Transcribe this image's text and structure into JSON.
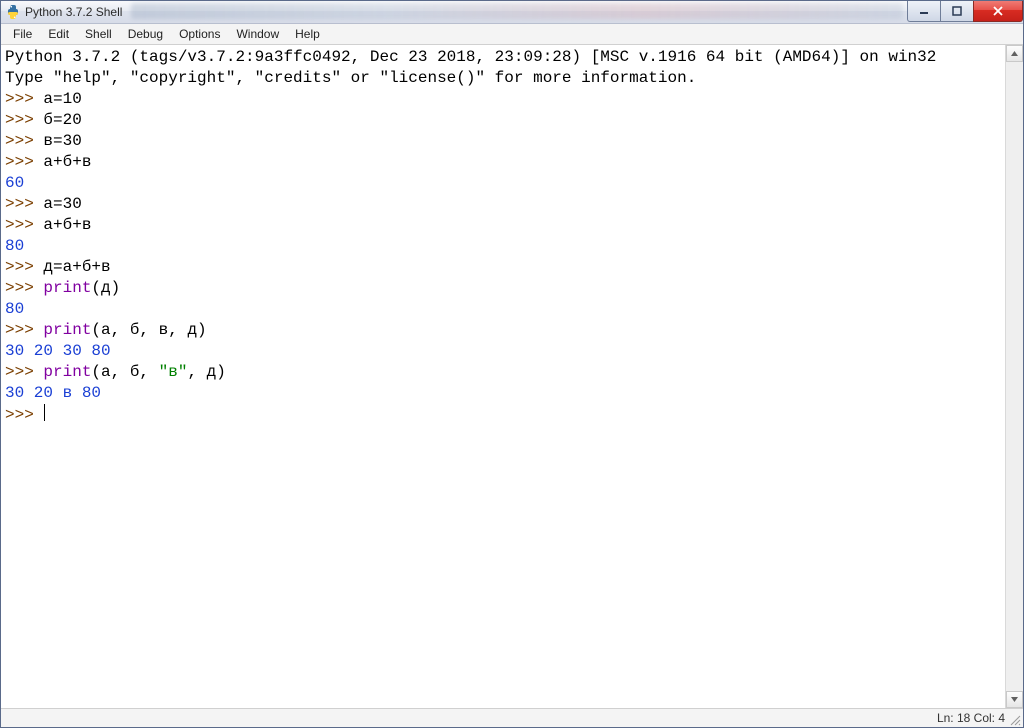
{
  "window": {
    "title": "Python 3.7.2 Shell"
  },
  "menubar": {
    "items": [
      "File",
      "Edit",
      "Shell",
      "Debug",
      "Options",
      "Window",
      "Help"
    ]
  },
  "terminal": {
    "banner1": "Python 3.7.2 (tags/v3.7.2:9a3ffc0492, Dec 23 2018, 23:09:28) [MSC v.1916 64 bit (AMD64)] on win32",
    "banner2": "Type \"help\", \"copyright\", \"credits\" or \"license()\" for more information.",
    "prompt": ">>> ",
    "lines": {
      "l1": "а=10",
      "l2": "б=20",
      "l3": "в=30",
      "l4": "а+б+в",
      "o1": "60",
      "l5": "а=30",
      "l6": "а+б+в",
      "o2": "80",
      "l7": "д=а+б+в",
      "l8_kw": "print",
      "l8_rest": "(д)",
      "o3": "80",
      "l9_kw": "print",
      "l9_rest": "(а, б, в, д)",
      "o4": "30 20 30 80",
      "l10_kw": "print",
      "l10_a": "(а, б, ",
      "l10_str": "\"в\"",
      "l10_b": ", д)",
      "o5": "30 20 в 80"
    }
  },
  "statusbar": {
    "position": "Ln: 18  Col: 4"
  }
}
